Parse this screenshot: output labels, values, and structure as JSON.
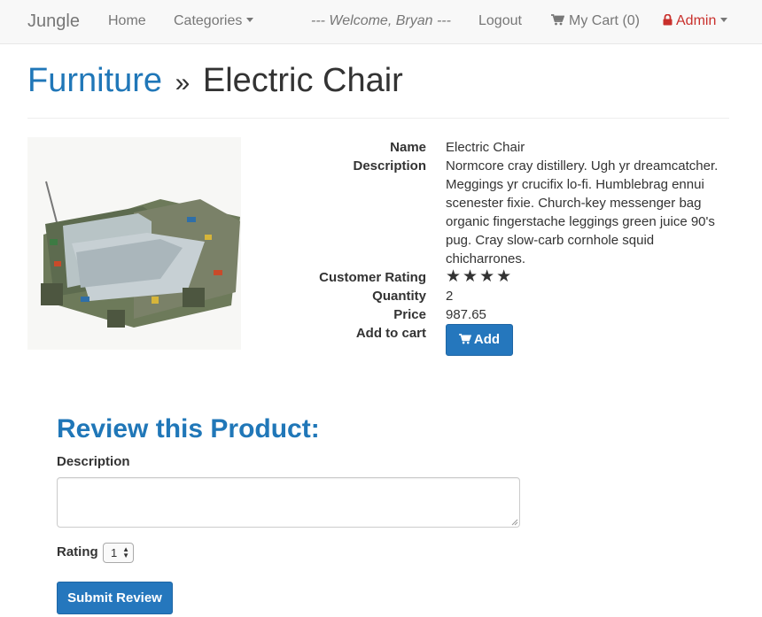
{
  "navbar": {
    "brand": "Jungle",
    "home": "Home",
    "categories": "Categories",
    "welcome": "--- Welcome, Bryan ---",
    "logout": "Logout",
    "cart": "My Cart (0)",
    "admin": "Admin"
  },
  "header": {
    "category": "Furniture",
    "separator": "»",
    "product": "Electric Chair"
  },
  "product": {
    "image_alt": "Electric chair made of circuit boards",
    "fields": {
      "name_label": "Name",
      "name": "Electric Chair",
      "description_label": "Description",
      "description": "Normcore cray distillery. Ugh yr dreamcatcher. Meggings yr crucifix lo-fi. Humblebrag ennui scenester fixie. Church-key messenger bag organic fingerstache leggings green juice 90's pug. Cray slow-carb cornhole squid chicharrones.",
      "rating_label": "Customer Rating",
      "rating_stars": "★★★★",
      "rating_value": 4,
      "quantity_label": "Quantity",
      "quantity": "2",
      "price_label": "Price",
      "price": "987.65",
      "cart_label": "Add to cart",
      "add_button": "Add"
    }
  },
  "review": {
    "title": "Review this Product:",
    "description_label": "Description",
    "description_value": "",
    "rating_label": "Rating",
    "rating_selected": "1",
    "submit": "Submit Review"
  },
  "colors": {
    "link_blue": "#2077b8",
    "button_blue": "#2577bd",
    "admin_red": "#c9302c",
    "navbar_bg": "#f8f8f8"
  },
  "icons": [
    "cart-icon",
    "lock-icon",
    "caret-down-icon",
    "star-icon",
    "select-arrows-icon"
  ]
}
